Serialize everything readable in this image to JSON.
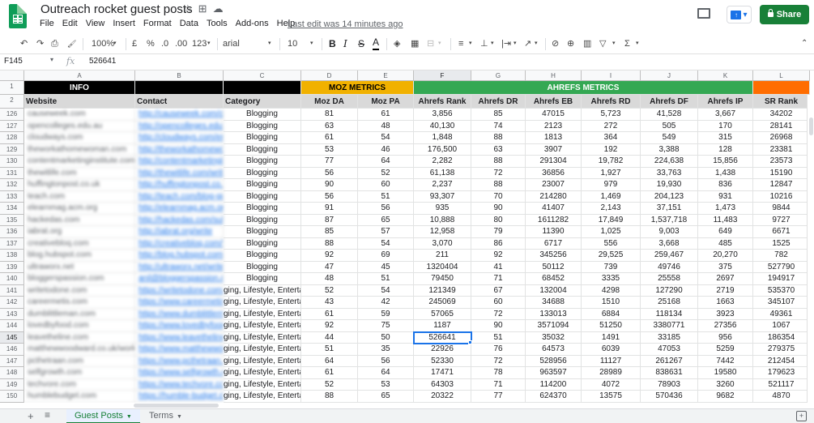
{
  "app": {
    "title": "Outreach rocket guest posts",
    "star_icon": "☆",
    "move_icon": "⊞",
    "cloud_icon": "☁",
    "last_edit": "Last edit was 14 minutes ago",
    "menu": [
      "File",
      "Edit",
      "View",
      "Insert",
      "Format",
      "Data",
      "Tools",
      "Add-ons",
      "Help"
    ],
    "share_label": "Share",
    "present_caret": "▾"
  },
  "toolbar": {
    "undo": "↶",
    "redo": "↷",
    "print": "⎙",
    "paint_format": "🖌",
    "zoom": "100%",
    "currency": "£",
    "percent": "%",
    "decimal_dec": ".0",
    "decimal_inc": ".00",
    "more_formats": "123",
    "font": "arial",
    "font_size": "10",
    "bold": "B",
    "italic": "I",
    "strike": "S",
    "text_color": "A",
    "fill_color": "◈",
    "borders": "▦",
    "merge": "⊟",
    "halign": "≡",
    "valign": "⊥",
    "wrap": "|⇥",
    "rotate": "↗",
    "link": "⊘",
    "comment": "⊕",
    "chart": "▥",
    "filter": "▽",
    "functions": "Σ",
    "caret": "▾"
  },
  "formula_bar": {
    "cell_ref": "F145",
    "fx": "fx",
    "value": "526641"
  },
  "columns": [
    "A",
    "B",
    "C",
    "D",
    "E",
    "F",
    "G",
    "H",
    "I",
    "J",
    "K",
    "L"
  ],
  "group_headers": [
    {
      "label": "INFO",
      "bg": "#000000",
      "color": "#ffffff"
    },
    {
      "label": "",
      "bg": "#000000",
      "color": "#ffffff"
    },
    {
      "label": "",
      "bg": "#000000",
      "color": "#ffffff"
    },
    {
      "label": "MOZ METRICS",
      "bg": "#f1b100",
      "color": "#000000"
    },
    {
      "label": "AHREFS METRICS",
      "bg": "#34a853",
      "color": "#ffffff"
    },
    {
      "label": "",
      "bg": "#ff6d01",
      "color": "#000000"
    }
  ],
  "field_headers": [
    "Website",
    "Contact",
    "Category",
    "Moz DA",
    "Moz PA",
    "Ahrefs Rank",
    "Ahrefs DR",
    "Ahrefs EB",
    "Ahrefs RD",
    "Ahrefs DF",
    "Ahrefs IP",
    "SR Rank"
  ],
  "rows": [
    {
      "n": "126",
      "site": "causeweek.com",
      "contact": "http://causeweek.com/contact",
      "cat": "Blogging",
      "da": "81",
      "pa": "61",
      "rank": "3,856",
      "dr": "85",
      "eb": "47015",
      "rd": "5,723",
      "df": "41,528",
      "ip": "3,667",
      "sr": "34202"
    },
    {
      "n": "127",
      "site": "opencolleges.edu.au",
      "contact": "http://opencolleges.edu.au/write",
      "cat": "Blogging",
      "da": "63",
      "pa": "48",
      "rank": "40,130",
      "dr": "74",
      "eb": "2123",
      "rd": "272",
      "df": "505",
      "ip": "170",
      "sr": "28141"
    },
    {
      "n": "128",
      "site": "cloudways.com",
      "contact": "http://cloudways.com/en/write",
      "cat": "Blogging",
      "da": "61",
      "pa": "54",
      "rank": "1,848",
      "dr": "88",
      "eb": "1813",
      "rd": "364",
      "df": "549",
      "ip": "315",
      "sr": "26968"
    },
    {
      "n": "129",
      "site": "theworkathomewoman.com",
      "contact": "http://theworkathomewoman.com",
      "cat": "Blogging",
      "da": "53",
      "pa": "46",
      "rank": "176,500",
      "dr": "63",
      "eb": "3907",
      "rd": "192",
      "df": "3,388",
      "ip": "128",
      "sr": "23381"
    },
    {
      "n": "130",
      "site": "contentmarketinginstitute.com",
      "contact": "http://contentmarketinginstitute",
      "cat": "Blogging",
      "da": "77",
      "pa": "64",
      "rank": "2,282",
      "dr": "88",
      "eb": "291304",
      "rd": "19,782",
      "df": "224,638",
      "ip": "15,856",
      "sr": "23573"
    },
    {
      "n": "131",
      "site": "thewitlife.com",
      "contact": "http://thewitlife.com/write",
      "cat": "Blogging",
      "da": "56",
      "pa": "52",
      "rank": "61,138",
      "dr": "72",
      "eb": "36856",
      "rd": "1,927",
      "df": "33,763",
      "ip": "1,438",
      "sr": "15190"
    },
    {
      "n": "132",
      "site": "huffingtonpost.co.uk",
      "contact": "http://huffingtonpost.co.uk/blog",
      "cat": "Blogging",
      "da": "90",
      "pa": "60",
      "rank": "2,237",
      "dr": "88",
      "eb": "23007",
      "rd": "979",
      "df": "19,930",
      "ip": "836",
      "sr": "12847"
    },
    {
      "n": "133",
      "site": "teach.com",
      "contact": "http://teach.com/blog-guest",
      "cat": "Blogging",
      "da": "56",
      "pa": "51",
      "rank": "93,307",
      "dr": "70",
      "eb": "214280",
      "rd": "1,469",
      "df": "204,123",
      "ip": "931",
      "sr": "10216"
    },
    {
      "n": "134",
      "site": "elearnmag.acm.org",
      "contact": "http://elearnmag.acm.org/write",
      "cat": "Blogging",
      "da": "91",
      "pa": "56",
      "rank": "935",
      "dr": "90",
      "eb": "41407",
      "rd": "2,143",
      "df": "37,151",
      "ip": "1,473",
      "sr": "9844"
    },
    {
      "n": "135",
      "site": "hackedas.com",
      "contact": "http://hackedas.com/submit",
      "cat": "Blogging",
      "da": "87",
      "pa": "65",
      "rank": "10,888",
      "dr": "80",
      "eb": "1611282",
      "rd": "17,849",
      "df": "1,537,718",
      "ip": "11,483",
      "sr": "9727"
    },
    {
      "n": "136",
      "site": "iabrat.org",
      "contact": "http://iabrat.org/write",
      "cat": "Blogging",
      "da": "85",
      "pa": "57",
      "rank": "12,958",
      "dr": "79",
      "eb": "11390",
      "rd": "1,025",
      "df": "9,003",
      "ip": "649",
      "sr": "6671"
    },
    {
      "n": "137",
      "site": "creativebloq.com",
      "contact": "http://creativebloq.com/write",
      "cat": "Blogging",
      "da": "88",
      "pa": "54",
      "rank": "3,070",
      "dr": "86",
      "eb": "6717",
      "rd": "556",
      "df": "3,668",
      "ip": "485",
      "sr": "1525"
    },
    {
      "n": "138",
      "site": "blog.hubspot.com",
      "contact": "http://blog.hubspot.com/guest",
      "cat": "Blogging",
      "da": "92",
      "pa": "69",
      "rank": "211",
      "dr": "92",
      "eb": "345256",
      "rd": "29,525",
      "df": "259,467",
      "ip": "20,270",
      "sr": "782"
    },
    {
      "n": "139",
      "site": "ultraworx.net",
      "contact": "http://ultraworx.net/write",
      "cat": "Blogging",
      "da": "47",
      "pa": "45",
      "rank": "1320404",
      "dr": "41",
      "eb": "50112",
      "rd": "739",
      "df": "49746",
      "ip": "375",
      "sr": "527790"
    },
    {
      "n": "140",
      "site": "bloggerspassion.com",
      "contact": "anil@bloggerspassion.com",
      "cat": "Blogging",
      "da": "48",
      "pa": "51",
      "rank": "79450",
      "dr": "71",
      "eb": "68452",
      "rd": "3335",
      "df": "25558",
      "ip": "2697",
      "sr": "194917"
    },
    {
      "n": "141",
      "site": "writetodone.com",
      "contact": "https://writetodone.com/guest",
      "cat": "ging, Lifestyle, Entertain",
      "da": "52",
      "pa": "54",
      "rank": "121349",
      "dr": "67",
      "eb": "132004",
      "rd": "4298",
      "df": "127290",
      "ip": "2719",
      "sr": "535370"
    },
    {
      "n": "142",
      "site": "careermetis.com",
      "contact": "https://www.careermetis.com/wr",
      "cat": "ging, Lifestyle, Entertain",
      "da": "43",
      "pa": "42",
      "rank": "245069",
      "dr": "60",
      "eb": "34688",
      "rd": "1510",
      "df": "25168",
      "ip": "1663",
      "sr": "345107"
    },
    {
      "n": "143",
      "site": "dumblittleman.com",
      "contact": "https://www.dumblittleman.com",
      "cat": "ging, Lifestyle, Entertain",
      "da": "61",
      "pa": "59",
      "rank": "57065",
      "dr": "72",
      "eb": "133013",
      "rd": "6884",
      "df": "118134",
      "ip": "3923",
      "sr": "49361"
    },
    {
      "n": "144",
      "site": "lovedbyfood.com",
      "contact": "https://www.lovedbyfood.com",
      "cat": "ging, Lifestyle, Entertain",
      "da": "92",
      "pa": "75",
      "rank": "1187",
      "dr": "90",
      "eb": "3571094",
      "rd": "51250",
      "df": "3380771",
      "ip": "27356",
      "sr": "1067"
    },
    {
      "n": "145",
      "site": "leavetheline.com",
      "contact": "https://www.leavetheline.com/w",
      "cat": "ging, Lifestyle, Entertain",
      "da": "44",
      "pa": "50",
      "rank": "526641",
      "dr": "51",
      "eb": "35032",
      "rd": "1491",
      "df": "33185",
      "ip": "956",
      "sr": "186354"
    },
    {
      "n": "146",
      "site": "matthewwoodward.co.uk/work",
      "contact": "https://www.matthewwoodward",
      "cat": "ging, Lifestyle, Entertain",
      "da": "51",
      "pa": "35",
      "rank": "22926",
      "dr": "76",
      "eb": "64573",
      "rd": "6039",
      "df": "47053",
      "ip": "5259",
      "sr": "279375"
    },
    {
      "n": "147",
      "site": "pcthetraan.com",
      "contact": "https://www.pcthetraan.com/gu",
      "cat": "ging, Lifestyle, Entertain",
      "da": "64",
      "pa": "56",
      "rank": "52330",
      "dr": "72",
      "eb": "528956",
      "rd": "11127",
      "df": "261267",
      "ip": "7442",
      "sr": "212454"
    },
    {
      "n": "148",
      "site": "selfgrowth.com",
      "contact": "https://www.selfgrowth.com/wr",
      "cat": "ging, Lifestyle, Entertain",
      "da": "61",
      "pa": "64",
      "rank": "17471",
      "dr": "78",
      "eb": "963597",
      "rd": "28989",
      "df": "838631",
      "ip": "19580",
      "sr": "179623"
    },
    {
      "n": "149",
      "site": "techvore.com",
      "contact": "https://www.techvore.com/write",
      "cat": "ging, Lifestyle, Entertain",
      "da": "52",
      "pa": "53",
      "rank": "64303",
      "dr": "71",
      "eb": "114200",
      "rd": "4072",
      "df": "78903",
      "ip": "3260",
      "sr": "521117"
    },
    {
      "n": "150",
      "site": "humblebudget.com",
      "contact": "https://humble-budget.com",
      "cat": "ging, Lifestyle, Entertain",
      "da": "88",
      "pa": "65",
      "rank": "20322",
      "dr": "77",
      "eb": "624370",
      "rd": "13575",
      "df": "570436",
      "ip": "9682",
      "sr": "4870"
    }
  ],
  "sheets": [
    {
      "name": "Guest Posts",
      "active": true
    },
    {
      "name": "Terms",
      "active": false
    }
  ],
  "sheetbar": {
    "add": "+",
    "all": "≡",
    "explore": "+"
  }
}
